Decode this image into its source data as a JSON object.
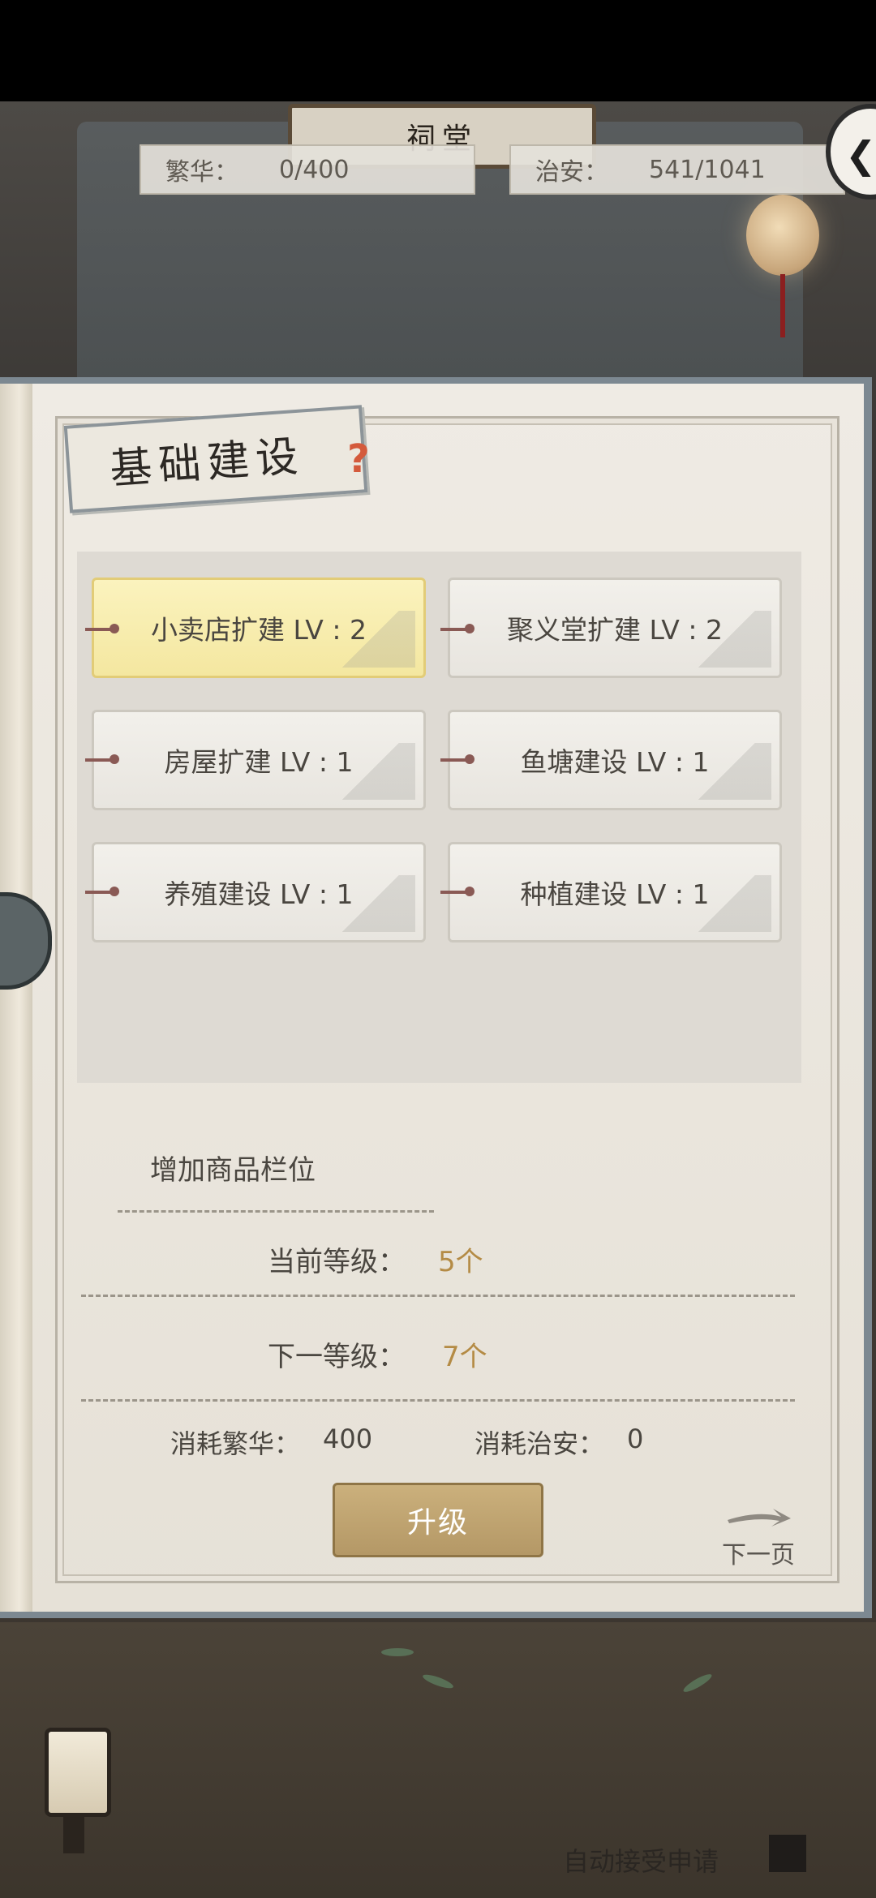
{
  "scene": {
    "sign_text": "祠堂"
  },
  "stats": {
    "prosperity_label": "繁华：",
    "prosperity_value": "0/400",
    "security_label": "治安：",
    "security_value": "541/1041"
  },
  "panel": {
    "title": "基础建设",
    "help": "?",
    "buildings": [
      {
        "label": "小卖店扩建 LV : 2",
        "selected": true
      },
      {
        "label": "聚义堂扩建 LV : 2",
        "selected": false
      },
      {
        "label": "房屋扩建 LV : 1",
        "selected": false
      },
      {
        "label": "鱼塘建设 LV : 1",
        "selected": false
      },
      {
        "label": "养殖建设 LV : 1",
        "selected": false
      },
      {
        "label": "种植建设 LV : 1",
        "selected": false
      }
    ]
  },
  "detail": {
    "heading": "增加商品栏位",
    "current_label": "当前等级：",
    "current_value": "5个",
    "next_label": "下一等级：",
    "next_value": "7个",
    "cost_prosperity_label": "消耗繁华：",
    "cost_prosperity_value": "400",
    "cost_security_label": "消耗治安：",
    "cost_security_value": "0"
  },
  "actions": {
    "upgrade": "升级",
    "next_page": "下一页",
    "auto_accept": "自动接受申请"
  },
  "colors": {
    "accent_gold": "#b48b45",
    "selected_yellow": "#fbf3be",
    "button_gold": "#c2a571"
  }
}
